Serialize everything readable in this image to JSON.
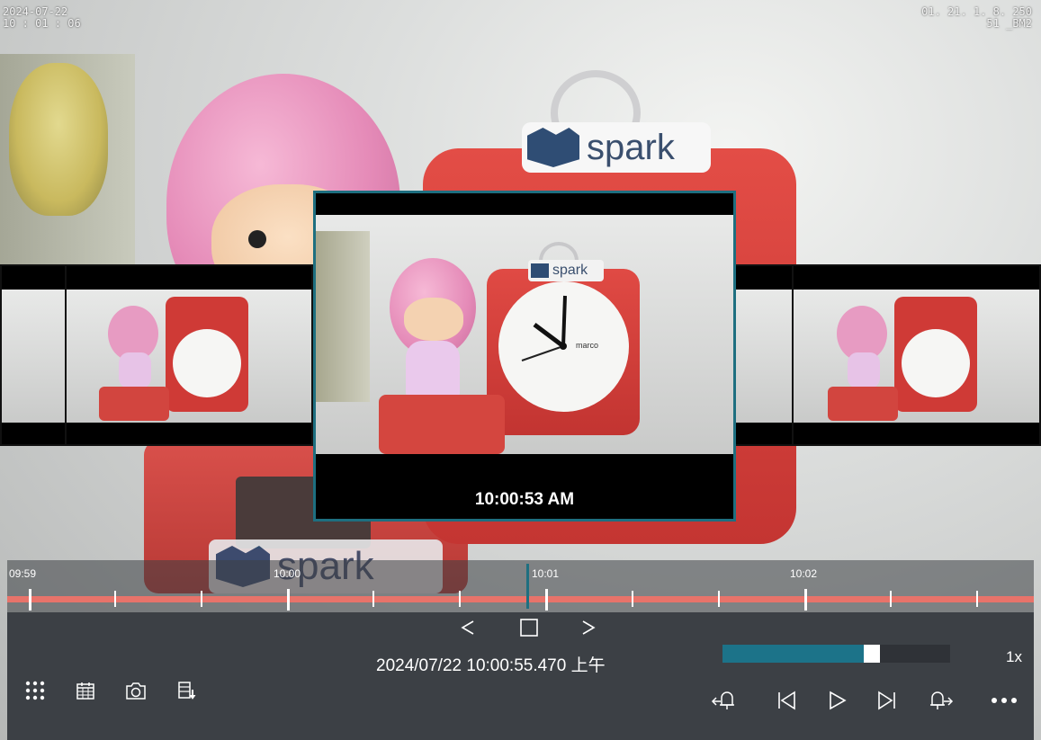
{
  "osd": {
    "date": "2024-07-22",
    "time": "10 : 01 : 06",
    "ip": "01. 21. 1. 8. 250",
    "camera": "51 _BM2"
  },
  "scene": {
    "brand_text": "spark"
  },
  "preview": {
    "time_label": "10:00:53 AM",
    "clock_brand": "marco"
  },
  "timeline": {
    "labels": [
      "09:59",
      "10:00",
      "10:01",
      "10:02"
    ]
  },
  "playback": {
    "datetime": "2024/07/22 10:00:55.470 上午",
    "speed_label": "1x",
    "speed_level": 0.62
  },
  "colors": {
    "accent": "#1e6f80",
    "timeline_bar": "#e8736a",
    "panel_bg": "#3c4045"
  },
  "icons": {
    "prev_frame": "chevron-left-icon",
    "stop": "stop-icon",
    "next_frame": "chevron-right-icon",
    "grid": "grid-icon",
    "calendar": "calendar-icon",
    "snapshot": "camera-icon",
    "export": "export-clip-icon",
    "prev_event": "prev-event-icon",
    "skip_back": "skip-back-icon",
    "play": "play-icon",
    "skip_forward": "skip-forward-icon",
    "next_event": "next-event-icon",
    "more": "more-icon"
  }
}
